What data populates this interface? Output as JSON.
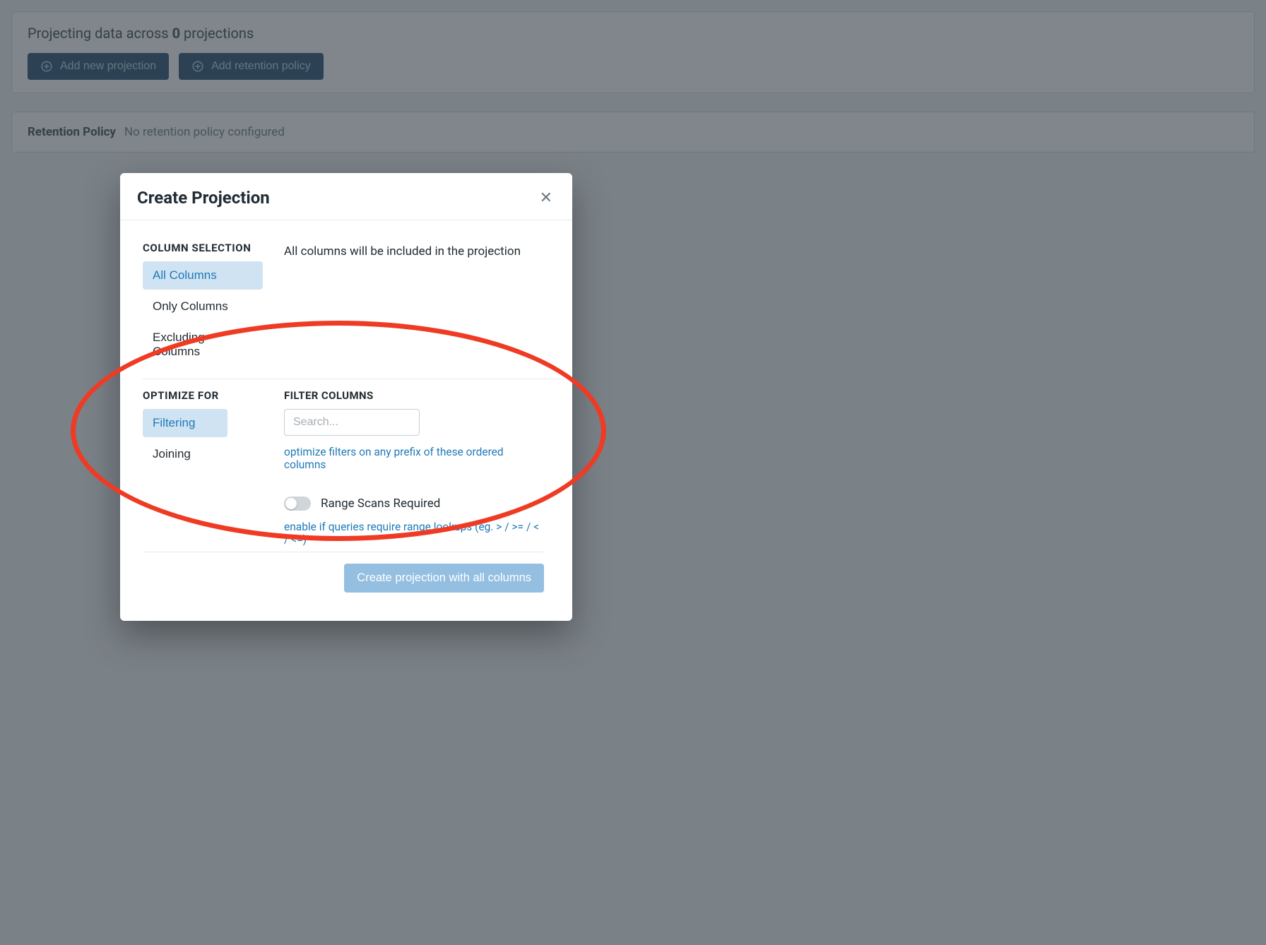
{
  "header": {
    "projecting_prefix": "Projecting data across ",
    "projecting_count": "0",
    "projecting_suffix": " projections"
  },
  "buttons": {
    "add_projection": "Add new projection",
    "add_retention": "Add retention policy"
  },
  "retention": {
    "label": "Retention Policy",
    "value": "No retention policy configured"
  },
  "modal": {
    "title": "Create Projection",
    "column_selection": {
      "heading": "COLUMN SELECTION",
      "tabs": {
        "all": "All Columns",
        "only": "Only Columns",
        "excluding": "Excluding Columns"
      },
      "desc": "All columns will be included in the projection"
    },
    "optimize": {
      "heading": "OPTIMIZE FOR",
      "tabs": {
        "filtering": "Filtering",
        "joining": "Joining"
      },
      "filter_heading": "FILTER COLUMNS",
      "search_placeholder": "Search...",
      "help1": "optimize filters on any prefix of these ordered columns",
      "toggle_label": "Range Scans Required",
      "help2": "enable if queries require range lookups (eg. > / >= / < / <=)"
    },
    "create_btn": "Create projection with all columns"
  }
}
